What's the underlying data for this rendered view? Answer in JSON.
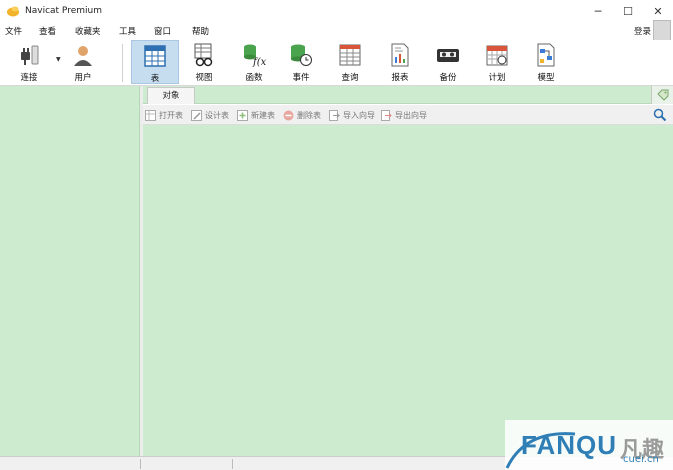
{
  "window": {
    "title": "Navicat Premium",
    "minimize": "─",
    "maximize": "☐",
    "close": "✕"
  },
  "menu": {
    "items": [
      "文件",
      "查看",
      "收藏夹",
      "工具",
      "窗口",
      "帮助"
    ],
    "login": "登录"
  },
  "toolbar": {
    "connect": "连接",
    "user": "用户",
    "table": "表",
    "view": "视图",
    "function": "函数",
    "event": "事件",
    "query": "查询",
    "report": "报表",
    "backup": "备份",
    "schedule": "计划",
    "model": "模型"
  },
  "tabs": {
    "objects": "对象"
  },
  "object_toolbar": {
    "open_table": "打开表",
    "design_table": "设计表",
    "new_table": "新建表",
    "delete_table": "删除表",
    "import_wizard": "导入向导",
    "export_wizard": "导出向导"
  },
  "watermark": {
    "brand": "FANQU",
    "cn": "凡趣",
    "url": "cuei.cn"
  },
  "colors": {
    "panel_green": "#cdebcf",
    "active_tool": "#c6dcef",
    "accent_blue": "#2f7fb6"
  }
}
